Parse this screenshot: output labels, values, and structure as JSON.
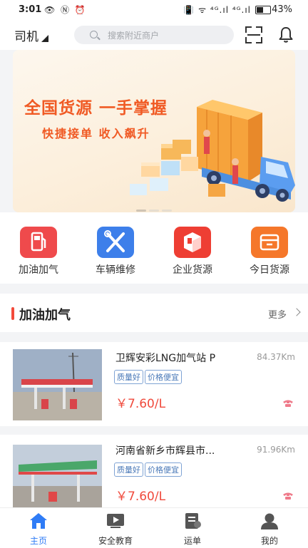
{
  "status_bar": {
    "time": "3:01",
    "left_icons": "👁 Ⓝ ⏰",
    "right_icons": "📳 ᯤ ⁴ᴳ.ıl ⁴ᴳ.ıl",
    "battery": "43%"
  },
  "header": {
    "role_label": "司机",
    "search_placeholder": "搜索附近商户",
    "icons": [
      "scan-icon",
      "bell-icon"
    ]
  },
  "banner": {
    "headline": "全国货源 一手掌握",
    "subline": "快捷接单 收入飙升"
  },
  "quick_actions": [
    {
      "label": "加油加气",
      "icon": "fuel-pump-icon",
      "color": "#ef4a4c"
    },
    {
      "label": "车辆维修",
      "icon": "tools-icon",
      "color": "#3d7fea"
    },
    {
      "label": "企业货源",
      "icon": "package-icon",
      "color": "#ee3e33"
    },
    {
      "label": "今日货源",
      "icon": "box-icon",
      "color": "#f5772a"
    }
  ],
  "section": {
    "title": "加油加气",
    "more": "更多"
  },
  "stations": [
    {
      "name": "卫辉安彩LNG加气站 P",
      "distance": "84.37Km",
      "tags": [
        "质量好",
        "价格便宜"
      ],
      "price": "￥7.60/L"
    },
    {
      "name": "河南省新乡市辉县市...",
      "distance": "91.96Km",
      "tags": [
        "质量好",
        "价格便宜"
      ],
      "price": "￥7.60/L"
    }
  ],
  "tabbar": [
    {
      "label": "主页",
      "icon": "home-icon",
      "active": true
    },
    {
      "label": "安全教育",
      "icon": "video-icon",
      "active": false
    },
    {
      "label": "运单",
      "icon": "waybill-icon",
      "active": false
    },
    {
      "label": "我的",
      "icon": "user-icon",
      "active": false
    }
  ],
  "colors": {
    "accent": "#2f7cf6",
    "price": "#f04a3c",
    "banner_text": "#f05a24"
  }
}
